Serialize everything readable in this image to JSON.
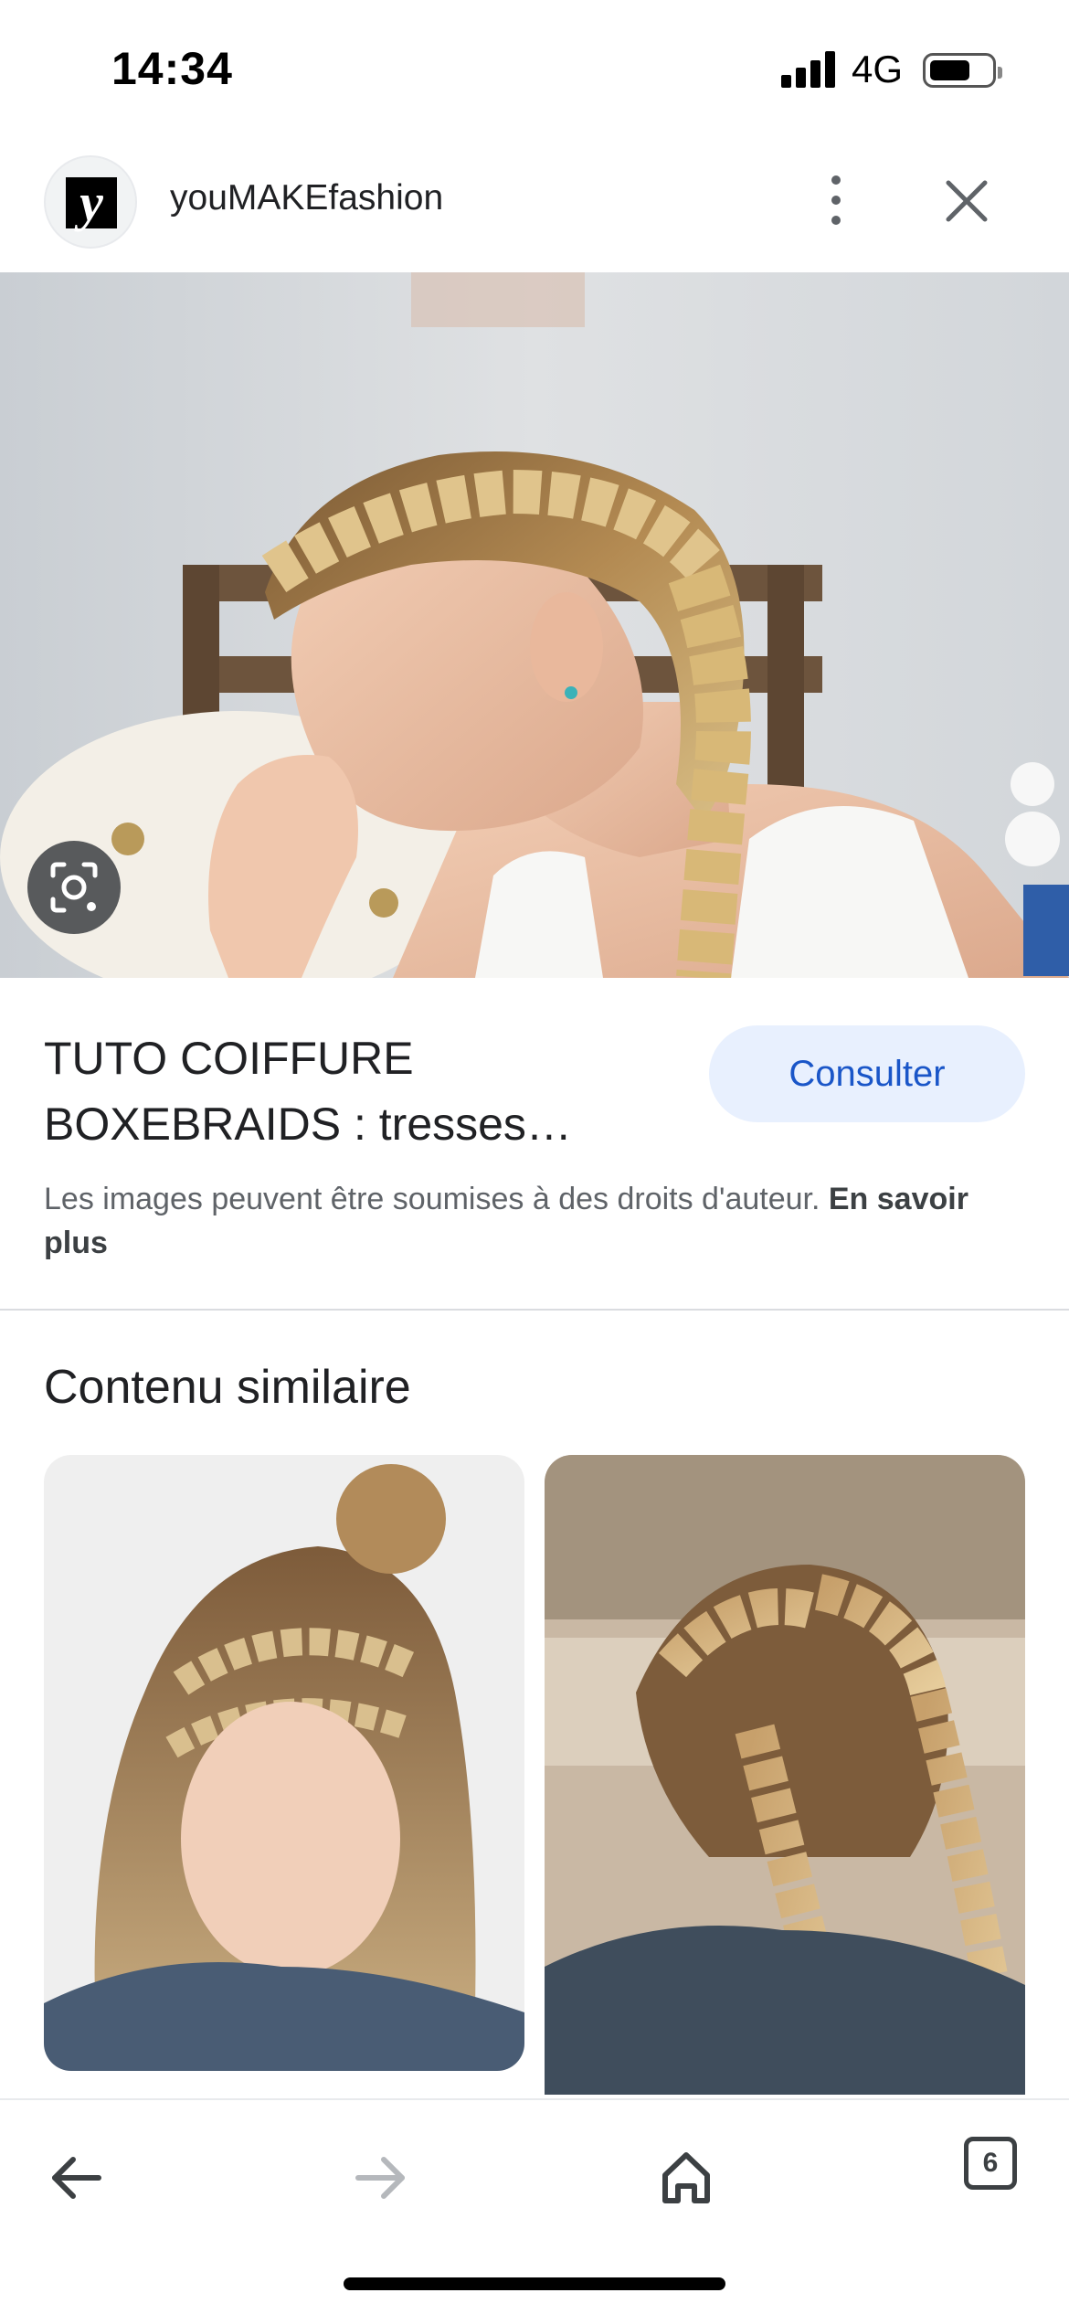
{
  "status_bar": {
    "time": "14:34",
    "network": "4G"
  },
  "header": {
    "site_name": "youMAKEfashion",
    "logo_letter": "y"
  },
  "result": {
    "title": "TUTO COIFFURE BOXEBRAIDS : tresses…",
    "consult_label": "Consulter",
    "copyright_text": "Les images peuvent être soumises à des droits d'auteur.",
    "learn_more_label": "En savoir plus"
  },
  "similar": {
    "title": "Contenu similaire"
  },
  "bottom_bar": {
    "tab_count": "6"
  },
  "icons": [
    "more-vert-icon",
    "close-icon",
    "google-lens-icon",
    "back-arrow-icon",
    "forward-arrow-icon",
    "home-icon",
    "tabs-icon"
  ],
  "colors": {
    "accent": "#1a56c8",
    "button_bg": "#e8f0fe",
    "text": "#202124",
    "secondary_text": "#5f6368"
  }
}
